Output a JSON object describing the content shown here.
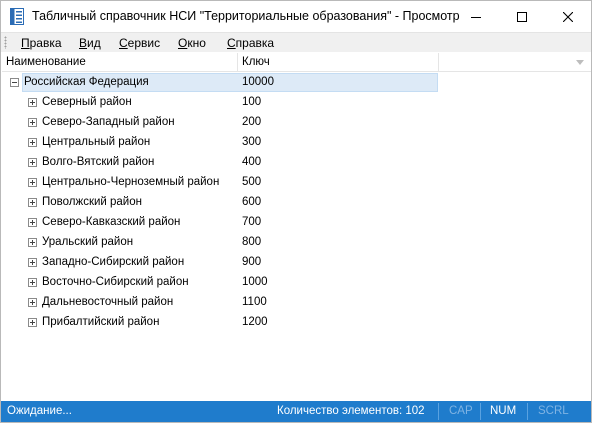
{
  "window": {
    "title": "Табличный справочник НСИ \"Территориальные образования\" - Просмотр"
  },
  "menu": [
    {
      "label": "Правка",
      "underline": "П",
      "rest": "равка"
    },
    {
      "label": "Вид",
      "underline": "В",
      "rest": "ид"
    },
    {
      "label": "Сервис",
      "underline": "С",
      "rest": "ервис"
    },
    {
      "label": "Окно",
      "underline": "О",
      "rest": "кно"
    },
    {
      "label": "Справка",
      "underline": "С",
      "rest": "правка"
    }
  ],
  "columns": {
    "name": "Наименование",
    "key": "Ключ"
  },
  "tree": {
    "root": {
      "name": "Российская Федерация",
      "key": "10000",
      "expanded": true,
      "selected": true
    },
    "children": [
      {
        "name": "Северный район",
        "key": "100"
      },
      {
        "name": "Северо-Западный район",
        "key": "200"
      },
      {
        "name": "Центральный район",
        "key": "300"
      },
      {
        "name": "Волго-Вятский район",
        "key": "400"
      },
      {
        "name": "Центрально-Черноземный район",
        "key": "500"
      },
      {
        "name": "Поволжский район",
        "key": "600"
      },
      {
        "name": "Северо-Кавказский район",
        "key": "700"
      },
      {
        "name": "Уральский район",
        "key": "800"
      },
      {
        "name": "Западно-Сибирский район",
        "key": "900"
      },
      {
        "name": "Восточно-Сибирский район",
        "key": "1000"
      },
      {
        "name": "Дальневосточный район",
        "key": "1100"
      },
      {
        "name": "Прибалтийский район",
        "key": "1200"
      }
    ]
  },
  "status": {
    "message": "Ожидание...",
    "count": "Количество элементов: 102",
    "indicators": [
      {
        "label": "CAP",
        "active": false
      },
      {
        "label": "NUM",
        "active": true
      },
      {
        "label": "SCRL",
        "active": false
      }
    ]
  },
  "colors": {
    "status_bar": "#1f7ccc",
    "selection": "#ddeaf7"
  },
  "icons": {
    "app": "document-table-icon",
    "minimize": "minimize-icon",
    "maximize": "maximize-icon",
    "close": "close-icon",
    "sort": "chevron-down-icon"
  }
}
